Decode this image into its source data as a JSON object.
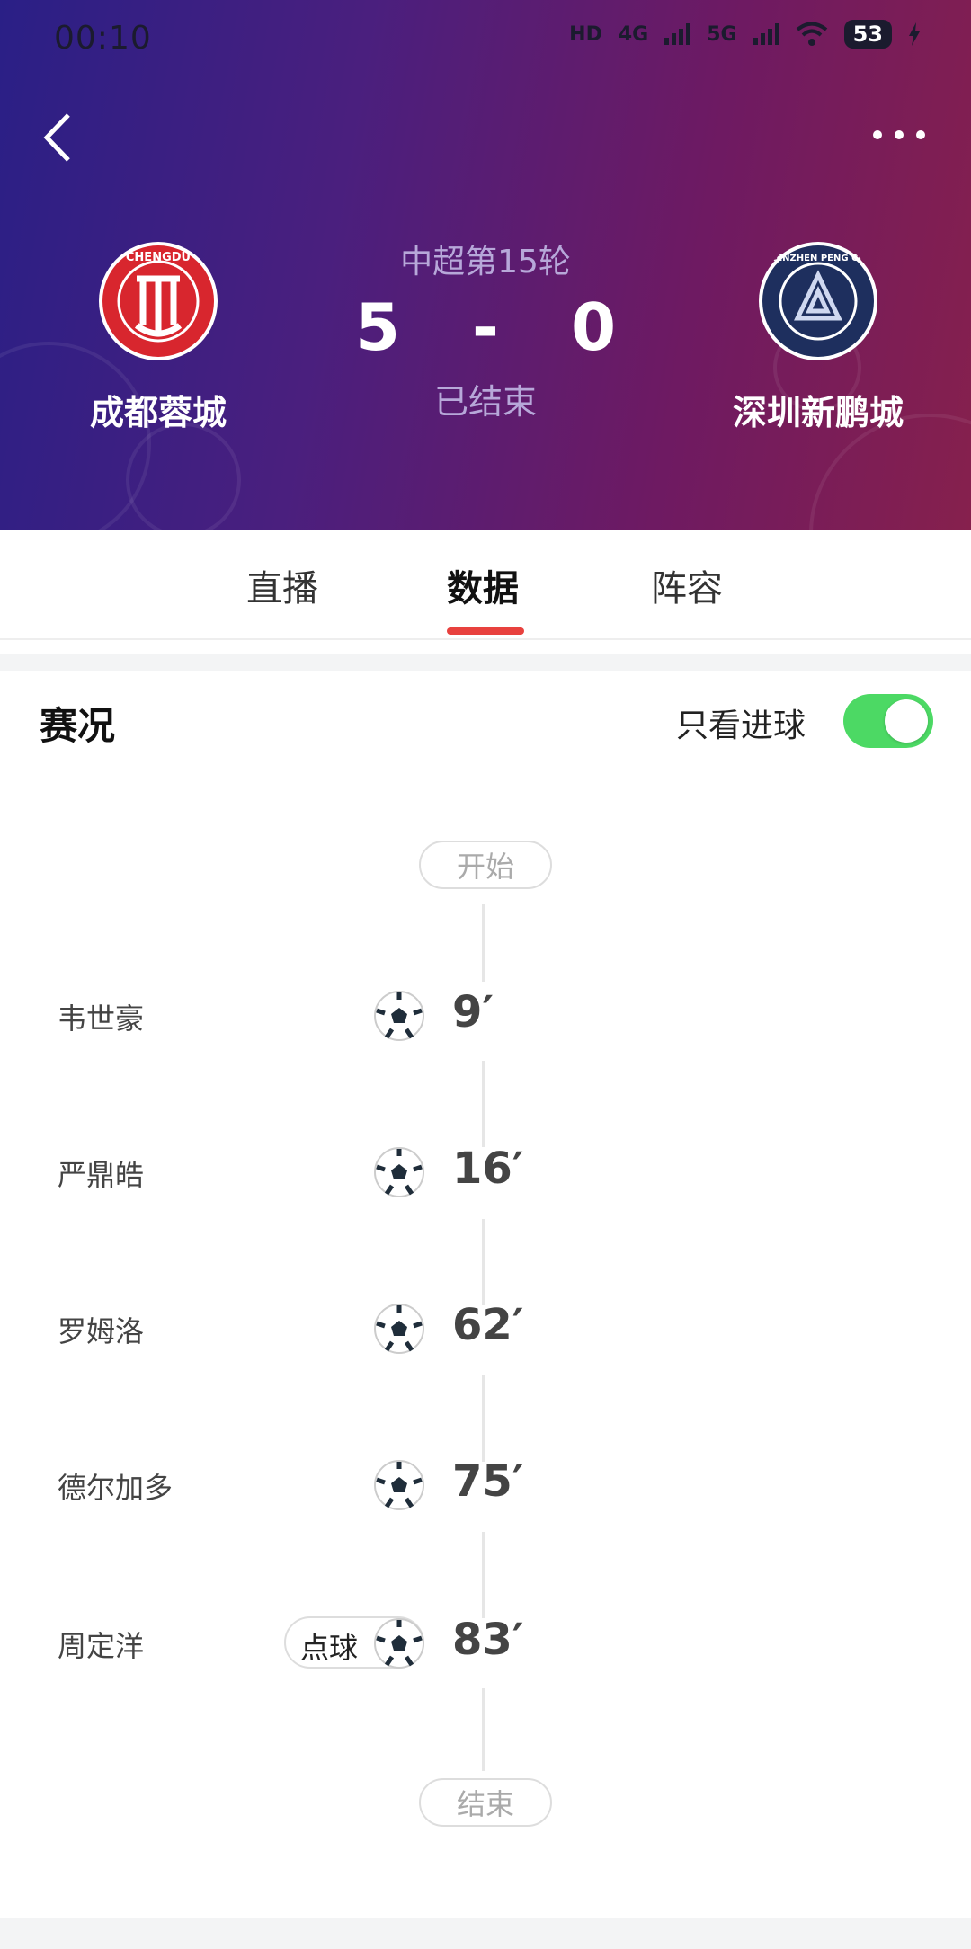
{
  "status_bar": {
    "time": "00:10",
    "battery": "53",
    "network_1": "4G",
    "network_2": "5G",
    "hd": "HD"
  },
  "header": {
    "round": "中超第15轮",
    "home_team": {
      "name": "成都蓉城",
      "logo_text": "CHENGDU",
      "score": "5"
    },
    "away_team": {
      "name": "深圳新鹏城",
      "logo_text": "SHENZHEN PENG CITY",
      "score": "0"
    },
    "separator": "-",
    "match_status": "已结束"
  },
  "tabs": [
    {
      "label": "直播"
    },
    {
      "label": "数据",
      "active": true
    },
    {
      "label": "阵容"
    }
  ],
  "events_section": {
    "title": "赛况",
    "filter_label": "只看进球",
    "filter_on": true,
    "start_label": "开始",
    "end_label": "结束",
    "events": [
      {
        "player": "韦世豪",
        "minute": "9′"
      },
      {
        "player": "严鼎皓",
        "minute": "16′"
      },
      {
        "player": "罗姆洛",
        "minute": "62′"
      },
      {
        "player": "德尔加多",
        "minute": "75′"
      },
      {
        "player": "周定洋",
        "minute": "83′",
        "tag": "点球"
      }
    ]
  },
  "colors": {
    "accent": "#e8413e",
    "toggle_on": "#4cd964",
    "home_red": "#d8262e",
    "away_navy": "#1e2f5e"
  }
}
